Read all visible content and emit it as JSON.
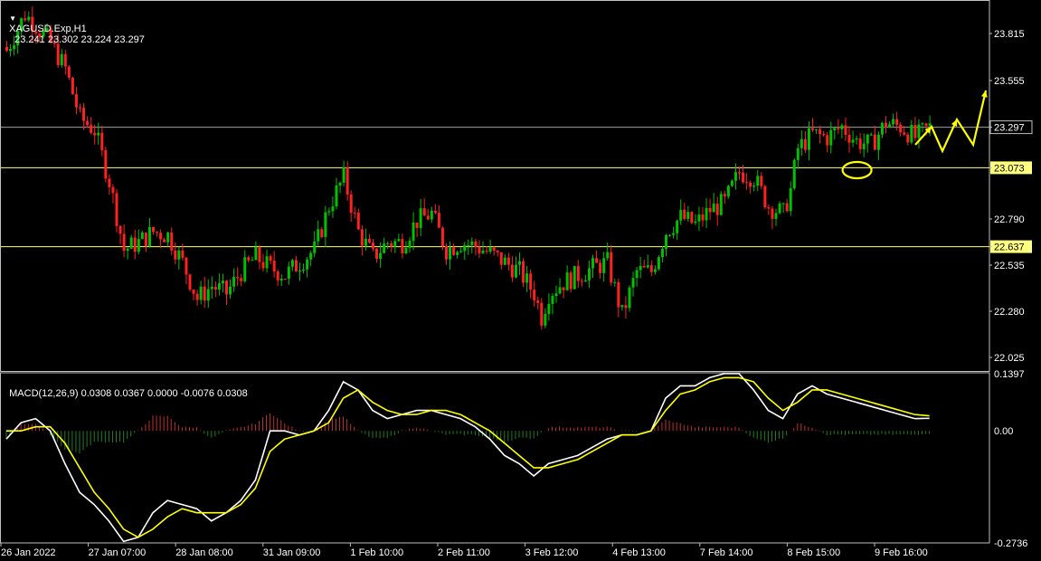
{
  "header": {
    "symbol_label": "XAGUSD.Exp,H1",
    "ohlc_label": "23.241 23.302 23.224 23.297",
    "menu_arrow_icon": "triangle-down-icon"
  },
  "macd_header": {
    "label": "MACD(12,26,9) 0.0308 0.0367 0.0000 -0.0076 0.0308"
  },
  "colors": {
    "background": "#000000",
    "bull": "#00c000",
    "bear": "#ff2020",
    "level_line": "#ffff80",
    "current_price_line": "#a0a0a0",
    "macd_main": "#ffffff",
    "macd_signal": "#ffff00",
    "annotation": "#ffff00"
  },
  "chart_data": [
    {
      "type": "candlestick",
      "title": "XAGUSD.Exp,H1",
      "timeframe": "H1",
      "ylim": [
        21.95,
        24.0
      ],
      "y_ticks": [
        "23.815",
        "23.555",
        "23.297",
        "23.073",
        "22.790",
        "22.637",
        "22.535",
        "22.280",
        "22.025"
      ],
      "x_ticks": [
        "26 Jan 2022",
        "27 Jan 07:00",
        "28 Jan 08:00",
        "31 Jan 09:00",
        "1 Feb 10:00",
        "2 Feb 11:00",
        "3 Feb 12:00",
        "4 Feb 13:00",
        "7 Feb 14:00",
        "8 Feb 15:00",
        "9 Feb 16:00"
      ],
      "close_path": [
        [
          0,
          23.72
        ],
        [
          2,
          23.8
        ],
        [
          5,
          23.92
        ],
        [
          8,
          23.86
        ],
        [
          12,
          23.76
        ],
        [
          16,
          23.62
        ],
        [
          20,
          23.35
        ],
        [
          24,
          23.28
        ],
        [
          28,
          23.0
        ],
        [
          32,
          22.62
        ],
        [
          36,
          22.66
        ],
        [
          40,
          22.72
        ],
        [
          44,
          22.7
        ],
        [
          48,
          22.55
        ],
        [
          52,
          22.35
        ],
        [
          56,
          22.42
        ],
        [
          60,
          22.38
        ],
        [
          64,
          22.5
        ],
        [
          68,
          22.58
        ],
        [
          72,
          22.52
        ],
        [
          76,
          22.48
        ],
        [
          80,
          22.55
        ],
        [
          84,
          22.62
        ],
        [
          88,
          22.86
        ],
        [
          92,
          23.02
        ],
        [
          96,
          22.72
        ],
        [
          100,
          22.58
        ],
        [
          104,
          22.66
        ],
        [
          108,
          22.66
        ],
        [
          112,
          22.78
        ],
        [
          116,
          22.82
        ],
        [
          120,
          22.62
        ],
        [
          124,
          22.66
        ],
        [
          128,
          22.64
        ],
        [
          132,
          22.6
        ],
        [
          136,
          22.55
        ],
        [
          140,
          22.5
        ],
        [
          144,
          22.38
        ],
        [
          146,
          22.25
        ],
        [
          148,
          22.38
        ],
        [
          152,
          22.44
        ],
        [
          156,
          22.48
        ],
        [
          160,
          22.52
        ],
        [
          164,
          22.55
        ],
        [
          168,
          22.26
        ],
        [
          172,
          22.5
        ],
        [
          176,
          22.5
        ],
        [
          180,
          22.72
        ],
        [
          184,
          22.8
        ],
        [
          188,
          22.76
        ],
        [
          192,
          22.84
        ],
        [
          196,
          22.88
        ],
        [
          200,
          23.05
        ],
        [
          204,
          23.02
        ],
        [
          208,
          22.86
        ],
        [
          212,
          22.82
        ],
        [
          214,
          22.95
        ],
        [
          216,
          23.18
        ],
        [
          220,
          23.26
        ],
        [
          224,
          23.24
        ],
        [
          228,
          23.3
        ],
        [
          232,
          23.22
        ],
        [
          236,
          23.2
        ],
        [
          240,
          23.32
        ],
        [
          244,
          23.3
        ],
        [
          248,
          23.24
        ],
        [
          252,
          23.297
        ]
      ],
      "horizontal_levels": [
        23.073,
        22.637
      ],
      "current_price": 23.297,
      "annotations": [
        "yellow ellipse at 8 Feb ~23.073 test",
        "yellow zig-zag forecast arrow pointing up to ~23.555"
      ]
    },
    {
      "type": "macd",
      "title": "MACD(12,26,9)",
      "params": [
        12,
        26,
        9
      ],
      "values": [
        0.0308,
        0.0367,
        0.0,
        -0.0076,
        0.0308
      ],
      "ylim": [
        -0.2736,
        0.1397
      ],
      "y_ticks": [
        "0.1397",
        "0.00",
        "-0.2736"
      ],
      "main_path": [
        [
          0,
          -0.02
        ],
        [
          4,
          0.02
        ],
        [
          8,
          0.03
        ],
        [
          12,
          0.0
        ],
        [
          16,
          -0.08
        ],
        [
          20,
          -0.15
        ],
        [
          24,
          -0.18
        ],
        [
          28,
          -0.22
        ],
        [
          32,
          -0.27
        ],
        [
          36,
          -0.26
        ],
        [
          40,
          -0.2
        ],
        [
          44,
          -0.17
        ],
        [
          48,
          -0.18
        ],
        [
          52,
          -0.19
        ],
        [
          56,
          -0.22
        ],
        [
          60,
          -0.2
        ],
        [
          64,
          -0.17
        ],
        [
          68,
          -0.12
        ],
        [
          72,
          0.0
        ],
        [
          76,
          0.0
        ],
        [
          80,
          -0.01
        ],
        [
          84,
          0.0
        ],
        [
          88,
          0.05
        ],
        [
          92,
          0.12
        ],
        [
          96,
          0.1
        ],
        [
          100,
          0.05
        ],
        [
          104,
          0.03
        ],
        [
          108,
          0.04
        ],
        [
          112,
          0.05
        ],
        [
          116,
          0.05
        ],
        [
          120,
          0.04
        ],
        [
          124,
          0.03
        ],
        [
          128,
          0.01
        ],
        [
          132,
          -0.02
        ],
        [
          136,
          -0.06
        ],
        [
          140,
          -0.08
        ],
        [
          144,
          -0.11
        ],
        [
          148,
          -0.08
        ],
        [
          152,
          -0.07
        ],
        [
          156,
          -0.06
        ],
        [
          160,
          -0.04
        ],
        [
          164,
          -0.02
        ],
        [
          168,
          -0.01
        ],
        [
          172,
          -0.01
        ],
        [
          176,
          0.0
        ],
        [
          180,
          0.08
        ],
        [
          184,
          0.11
        ],
        [
          188,
          0.11
        ],
        [
          192,
          0.13
        ],
        [
          196,
          0.14
        ],
        [
          200,
          0.14
        ],
        [
          204,
          0.1
        ],
        [
          208,
          0.05
        ],
        [
          212,
          0.03
        ],
        [
          216,
          0.09
        ],
        [
          220,
          0.11
        ],
        [
          224,
          0.09
        ],
        [
          228,
          0.08
        ],
        [
          232,
          0.07
        ],
        [
          236,
          0.06
        ],
        [
          240,
          0.05
        ],
        [
          244,
          0.04
        ],
        [
          248,
          0.03
        ],
        [
          252,
          0.0308
        ]
      ],
      "signal_path": [
        [
          0,
          0.0
        ],
        [
          4,
          0.0
        ],
        [
          8,
          0.01
        ],
        [
          12,
          0.01
        ],
        [
          16,
          -0.03
        ],
        [
          20,
          -0.09
        ],
        [
          24,
          -0.15
        ],
        [
          28,
          -0.19
        ],
        [
          32,
          -0.24
        ],
        [
          36,
          -0.26
        ],
        [
          40,
          -0.24
        ],
        [
          44,
          -0.21
        ],
        [
          48,
          -0.19
        ],
        [
          52,
          -0.2
        ],
        [
          56,
          -0.2
        ],
        [
          60,
          -0.2
        ],
        [
          64,
          -0.18
        ],
        [
          68,
          -0.14
        ],
        [
          72,
          -0.05
        ],
        [
          76,
          -0.02
        ],
        [
          80,
          -0.01
        ],
        [
          84,
          0.0
        ],
        [
          88,
          0.02
        ],
        [
          92,
          0.08
        ],
        [
          96,
          0.1
        ],
        [
          100,
          0.07
        ],
        [
          104,
          0.05
        ],
        [
          108,
          0.04
        ],
        [
          112,
          0.04
        ],
        [
          116,
          0.05
        ],
        [
          120,
          0.05
        ],
        [
          124,
          0.04
        ],
        [
          128,
          0.02
        ],
        [
          132,
          0.0
        ],
        [
          136,
          -0.03
        ],
        [
          140,
          -0.06
        ],
        [
          144,
          -0.09
        ],
        [
          148,
          -0.09
        ],
        [
          152,
          -0.08
        ],
        [
          156,
          -0.07
        ],
        [
          160,
          -0.05
        ],
        [
          164,
          -0.03
        ],
        [
          168,
          -0.01
        ],
        [
          172,
          -0.01
        ],
        [
          176,
          0.0
        ],
        [
          180,
          0.05
        ],
        [
          184,
          0.09
        ],
        [
          188,
          0.1
        ],
        [
          192,
          0.12
        ],
        [
          196,
          0.13
        ],
        [
          200,
          0.13
        ],
        [
          204,
          0.12
        ],
        [
          208,
          0.08
        ],
        [
          212,
          0.05
        ],
        [
          216,
          0.07
        ],
        [
          220,
          0.1
        ],
        [
          224,
          0.1
        ],
        [
          228,
          0.09
        ],
        [
          232,
          0.08
        ],
        [
          236,
          0.07
        ],
        [
          240,
          0.06
        ],
        [
          244,
          0.05
        ],
        [
          248,
          0.04
        ],
        [
          252,
          0.0367
        ]
      ]
    }
  ]
}
